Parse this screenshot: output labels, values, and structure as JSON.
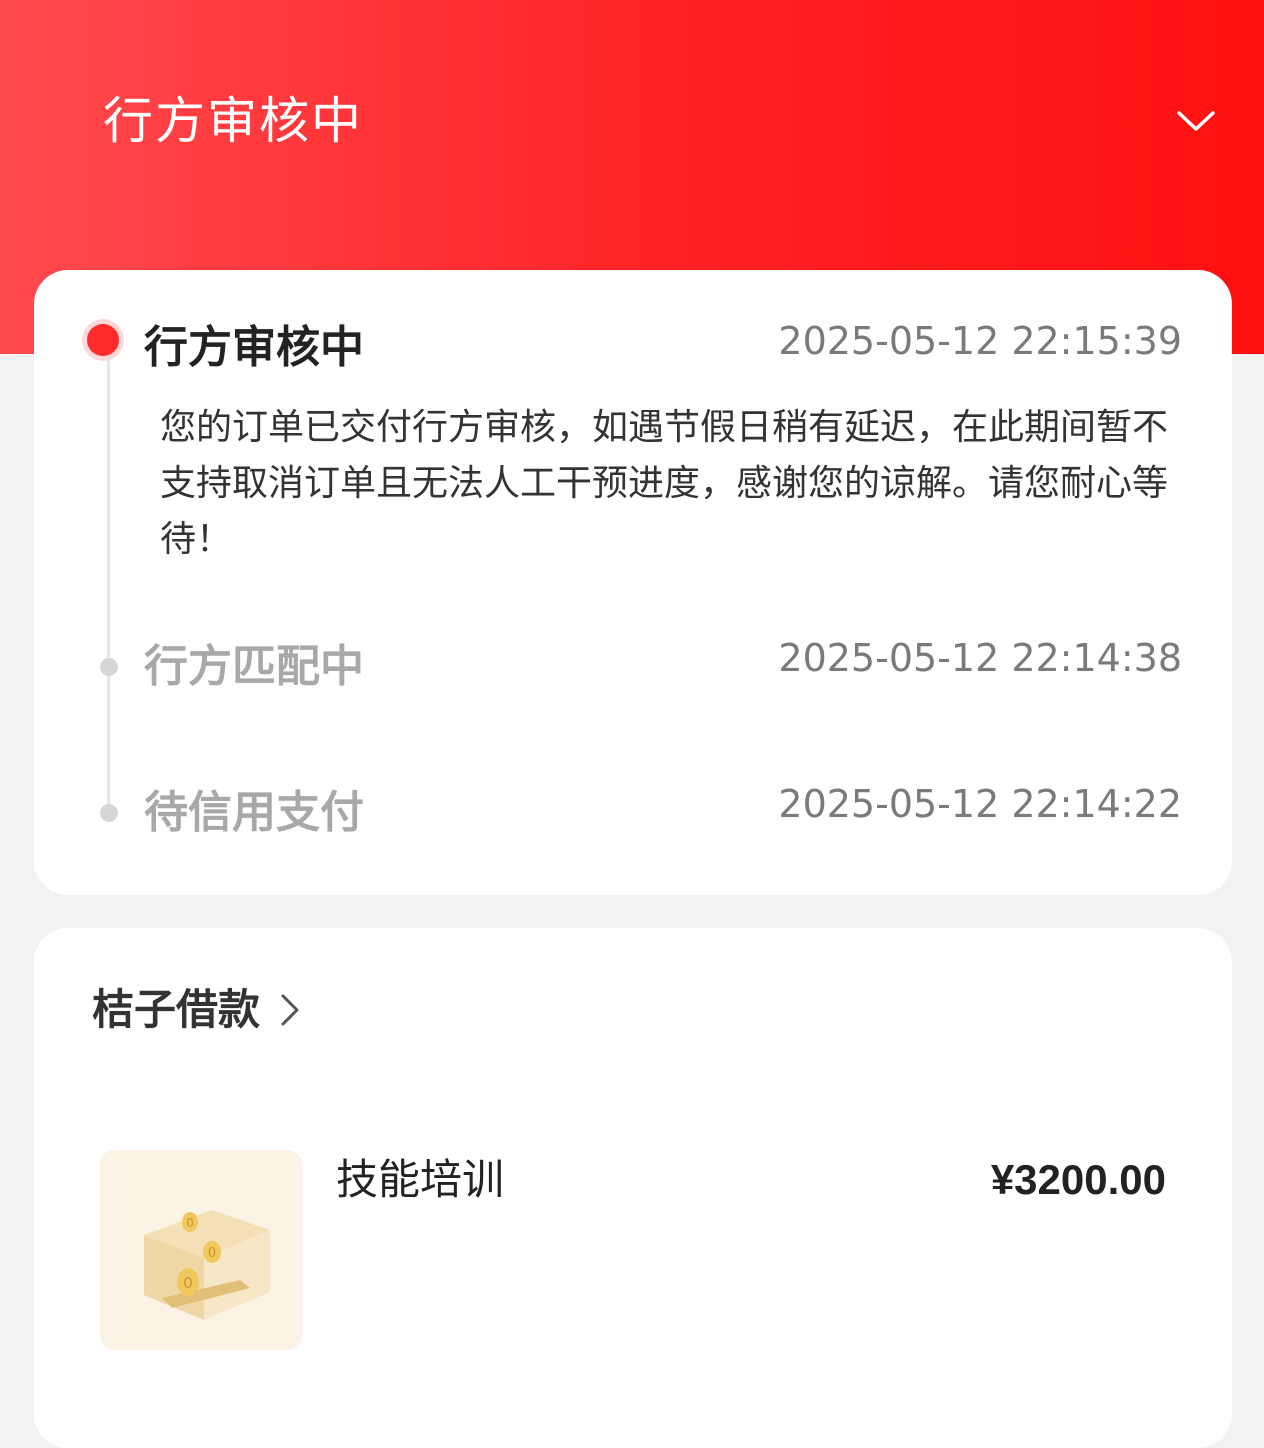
{
  "header": {
    "title": "行方审核中",
    "expand_icon": "chevron-down-icon"
  },
  "timeline": {
    "steps": [
      {
        "title": "行方审核中",
        "time": "2025-05-12 22:15:39",
        "description": "您的订单已交付行方审核，如遇节假日稍有延迟，在此期间暂不支持取消订单且无法人工干预进度，感谢您的谅解。请您耐心等待！",
        "active": true
      },
      {
        "title": "行方匹配中",
        "time": "2025-05-12 22:14:38",
        "active": false
      },
      {
        "title": "待信用支付",
        "time": "2025-05-12 22:14:22",
        "active": false
      }
    ]
  },
  "order": {
    "merchant": "桔子借款",
    "merchant_icon": "chevron-right-icon",
    "product_name": "技能培训",
    "price": "¥3200.00",
    "thumbnail_icon": "coin-box-icon"
  },
  "colors": {
    "brand_red": "#ff2024",
    "active_dot": "#ff2a2a",
    "inactive_text": "#a8a8a8"
  }
}
